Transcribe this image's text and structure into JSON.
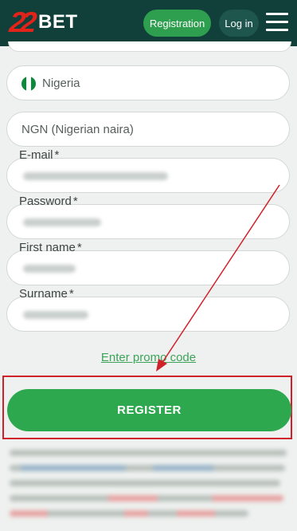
{
  "header": {
    "logo_number": "22",
    "logo_text": "BET",
    "registration_label": "Registration",
    "login_label": "Log in"
  },
  "form": {
    "country": "Nigeria",
    "currency": "NGN (Nigerian naira)",
    "email_label": "E-mail",
    "password_label": "Password",
    "first_name_label": "First name",
    "surname_label": "Surname",
    "required_mark": "*",
    "promo_link": "Enter promo code",
    "register_button": "REGISTER"
  },
  "colors": {
    "header_bg": "#11403a",
    "accent_green": "#2ea84f",
    "annotation_red": "#d0202a",
    "flag_green": "#0a8a3a"
  },
  "icons": {
    "menu": "hamburger-menu-icon",
    "flag": "nigeria-flag-icon"
  }
}
